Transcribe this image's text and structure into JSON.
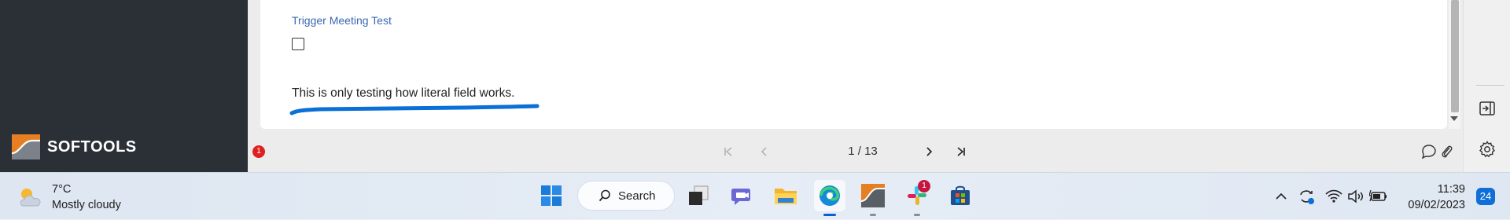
{
  "brand": {
    "name": "SOFTOOLS"
  },
  "form": {
    "field_label": "Trigger Meeting Test",
    "checkbox_checked": false,
    "literal_text": "This is only testing how literal field works."
  },
  "pager": {
    "page_info": "1 / 13"
  },
  "warning_badge": "1",
  "colors": {
    "sidebar": "#2b3037",
    "link": "#3a67b0",
    "underline": "#0a6fd6",
    "accent": "#e67e22"
  },
  "taskbar": {
    "weather_temp": "7°C",
    "weather_desc": "Mostly cloudy",
    "search_label": "Search",
    "slack_badge": "1",
    "time": "11:39",
    "date": "09/02/2023",
    "notification_count": "24"
  }
}
